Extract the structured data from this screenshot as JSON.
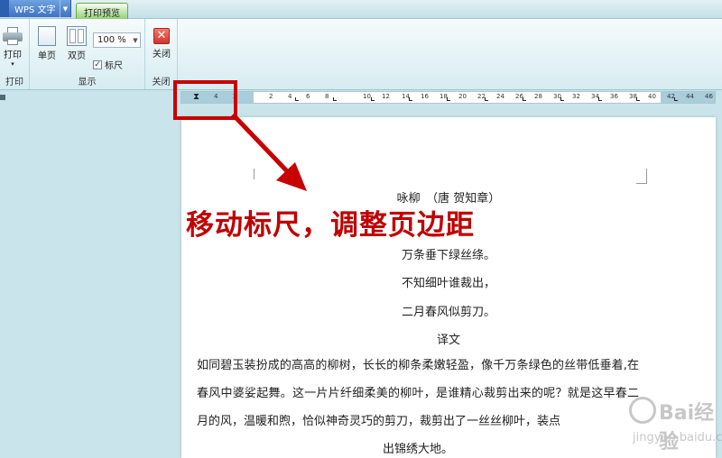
{
  "titlebar": {
    "app_label": "WPS 文字",
    "tab_label": "打印预览"
  },
  "ribbon": {
    "print_label": "打印",
    "print_group": "打印",
    "single_page_label": "单页",
    "double_page_label": "双页",
    "zoom_value": "100 %",
    "ruler_label": "标尺",
    "display_group": "显示",
    "close_label": "关闭",
    "close_group": "关闭"
  },
  "ruler": {
    "ticks": [
      "4",
      "2",
      "2",
      "4",
      "6",
      "8",
      "10",
      "12",
      "14",
      "16",
      "18",
      "20",
      "22",
      "24",
      "26",
      "28",
      "30",
      "32",
      "34",
      "36",
      "38",
      "40",
      "42",
      "44",
      "46",
      "48"
    ]
  },
  "document": {
    "title": "咏柳　（唐 贺知章）",
    "line1": "万条垂下绿丝绦。",
    "line2": "不知细叶谁裁出，",
    "line3": "二月春风似剪刀。",
    "section": "译文",
    "paragraph": "如同碧玉装扮成的高高的柳树，长长的柳条柔嫩轻盈，像千万条绿色的丝带低垂着,在春风中婆娑起舞。这一片片纤细柔美的柳叶，是谁精心裁剪出来的呢？就是这早春二月的风，温暖和煦，恰似神奇灵巧的剪刀，裁剪出了一丝丝柳叶，装点",
    "paragraph_end": "出锦绣大地。"
  },
  "annotation": {
    "overlay_text": "移动标尺，调整页边距",
    "color": "#c00000"
  },
  "watermark": {
    "brand": "Bai经验",
    "url": "jingyan.baidu.com"
  }
}
